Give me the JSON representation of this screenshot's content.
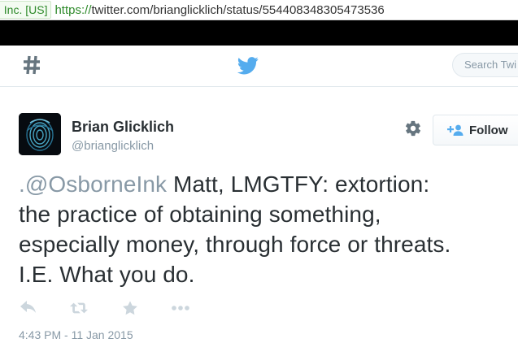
{
  "browser": {
    "ev_badge": ", Inc. [US]",
    "url_protocol": "https://",
    "url_rest": "twitter.com/brianglicklich/status/554408348305473536"
  },
  "topbar": {
    "search_placeholder": "Search Twi",
    "brand_color": "#55acee"
  },
  "tweet": {
    "fullname": "Brian Glicklich",
    "screenname": "@brianglicklich",
    "follow_label": "Follow",
    "text_prefix": ".",
    "mention": "@OsborneInk",
    "text_line1_rest": " Matt, LMGTFY: extortion:",
    "text_line2": "the practice of obtaining something,",
    "text_line3": "especially money, through force or threats.",
    "text_line4": "I.E. What you do.",
    "timestamp": "4:43 PM - 11 Jan 2015",
    "icons": {
      "avatar": "fingerprint-avatar",
      "gear": "gear-icon",
      "reply": "reply-icon",
      "retweet": "retweet-icon",
      "favorite": "star-icon",
      "more": "more-icon"
    }
  }
}
